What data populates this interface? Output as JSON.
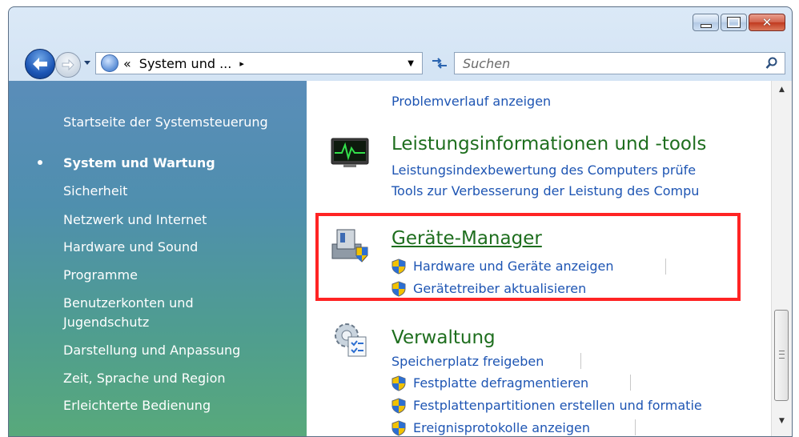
{
  "window": {
    "caption_buttons": {
      "minimize": "minimize-icon",
      "maximize": "maximize-icon",
      "close": "close-icon"
    }
  },
  "navigation": {
    "address": {
      "separator": "«",
      "location": "System und ...",
      "expand_arrow": "▸"
    },
    "search": {
      "placeholder": "Suchen"
    }
  },
  "sidebar": {
    "home": "Startseite der Systemsteuerung",
    "items": [
      {
        "label": "System und Wartung",
        "selected": true
      },
      {
        "label": "Sicherheit"
      },
      {
        "label": "Netzwerk und Internet"
      },
      {
        "label": "Hardware und Sound"
      },
      {
        "label": "Programme"
      },
      {
        "label": "Benutzerkonten und",
        "label2": "Jugendschutz"
      },
      {
        "label": "Darstellung und Anpassung"
      },
      {
        "label": "Zeit, Sprache und Region"
      },
      {
        "label": "Erleichterte Bedienung"
      }
    ]
  },
  "content": {
    "top_link": "Problemverlauf anzeigen",
    "categories": [
      {
        "title": "Leistungsinformationen und -tools",
        "icon": "performance-monitor-icon",
        "links": [
          {
            "label": "Leistungsindexbewertung des Computers prüfe"
          },
          {
            "label": "Tools zur Verbesserung der Leistung des Compu"
          }
        ]
      },
      {
        "title": "Geräte-Manager",
        "icon": "device-manager-icon",
        "highlighted": true,
        "links": [
          {
            "label": "Hardware und Geräte anzeigen",
            "shield": true
          },
          {
            "label": "Gerätetreiber aktualisieren",
            "shield": true
          }
        ]
      },
      {
        "title": "Verwaltung",
        "icon": "administrative-tools-icon",
        "links": [
          {
            "label": "Speicherplatz freigeben"
          },
          {
            "label": "Festplatte defragmentieren",
            "shield": true
          },
          {
            "label": "Festplattenpartitionen erstellen und formatie",
            "shield": true
          },
          {
            "label": "Ereignisprotokolle anzeigen",
            "shield": true
          }
        ]
      }
    ]
  },
  "colors": {
    "link": "#1e55b3",
    "category_title": "#1e6e1e",
    "highlight_border": "#ff2424",
    "sidebar_top": "#5a8db9",
    "sidebar_bottom": "#58a97b"
  }
}
